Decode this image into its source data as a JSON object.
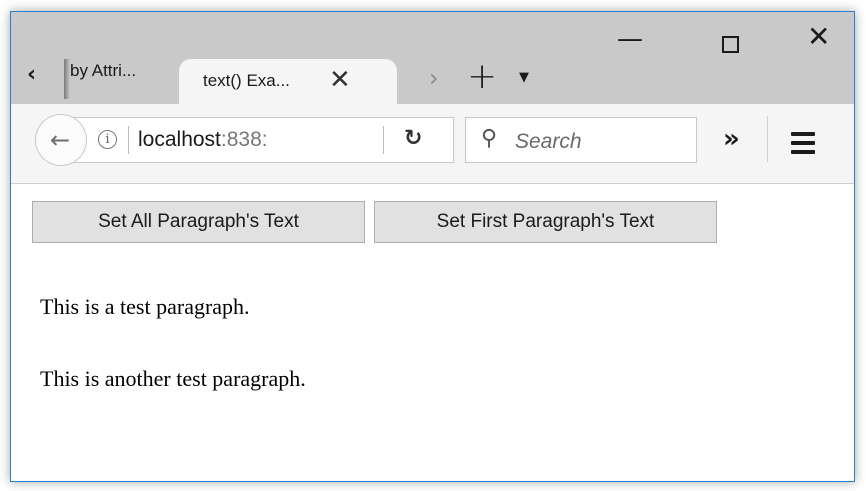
{
  "tabs": [
    {
      "label": "by Attri..."
    },
    {
      "label": "text() Exa..."
    }
  ],
  "toolbar": {
    "url_host": "localhost",
    "url_port": ":838:",
    "search_placeholder": "Search",
    "overflow_glyph": "»"
  },
  "page": {
    "buttons": [
      {
        "label": "Set All Paragraph's Text"
      },
      {
        "label": "Set First Paragraph's Text"
      }
    ],
    "paragraphs": [
      {
        "text": "This is a test paragraph."
      },
      {
        "text": "This is another test paragraph."
      }
    ]
  }
}
